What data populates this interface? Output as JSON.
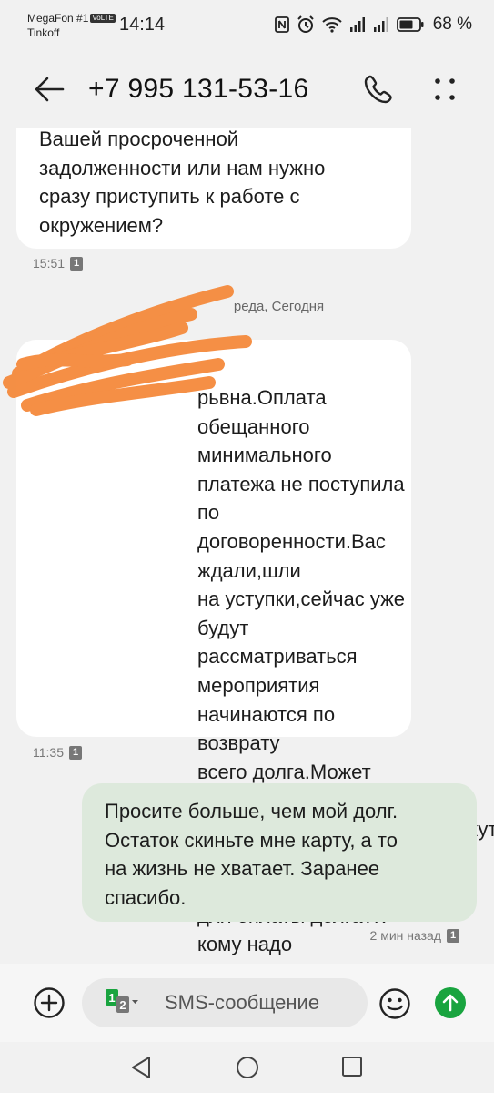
{
  "status_bar": {
    "carrier_1": "MegaFon #1",
    "volte": "VoLTE",
    "carrier_2": "Tinkoff",
    "time": "14:14",
    "battery": "68 %"
  },
  "header": {
    "contact": "+7 995 131-53-16"
  },
  "thread": {
    "messages": [
      {
        "direction": "incoming",
        "text": "Вашей просроченной\nзадолженности или нам нужно\nсразу приступить к работе с\nокружением?",
        "time": "15:51",
        "sim": "1"
      },
      {
        "direction": "incoming",
        "text": "рьвна.Оплата\nобещанного минимального\nплатежа не поступила по\nдоговоренности.Вас ждали,шли\nна уступки,сейчас уже будут\nрассматриваться мероприятия\nначинаются по возврату\nвсего долга.Может быть вся\nродня,знакомые,коллеги,окажут\nвам помощь со сбором денег\nдля оплаты долга?К кому надо\nобратиться в первую очередь?",
        "time": "11:35",
        "sim": "1"
      },
      {
        "direction": "outgoing",
        "text": "Просите больше, чем мой долг.\nОстаток скиньте мне карту, а то\nна жизнь не хватает. Заранее\nспасибо.",
        "time": "2 мин назад",
        "sim": "1"
      }
    ],
    "date_separator": "реда, Сегодня"
  },
  "composer": {
    "placeholder": "SMS-сообщение",
    "sim_primary": "1",
    "sim_secondary": "2"
  },
  "colors": {
    "send": "#19a43f",
    "outgoing_bubble": "#dde9dc",
    "incoming_bubble": "#ffffff",
    "scribble": "#f58a3c"
  },
  "icons": [
    "back-arrow-icon",
    "phone-icon",
    "more-vertical-icon",
    "add-circle-icon",
    "sim-switch-icon",
    "emoji-icon",
    "send-icon",
    "nav-back-icon",
    "nav-home-icon",
    "nav-recent-icon"
  ]
}
